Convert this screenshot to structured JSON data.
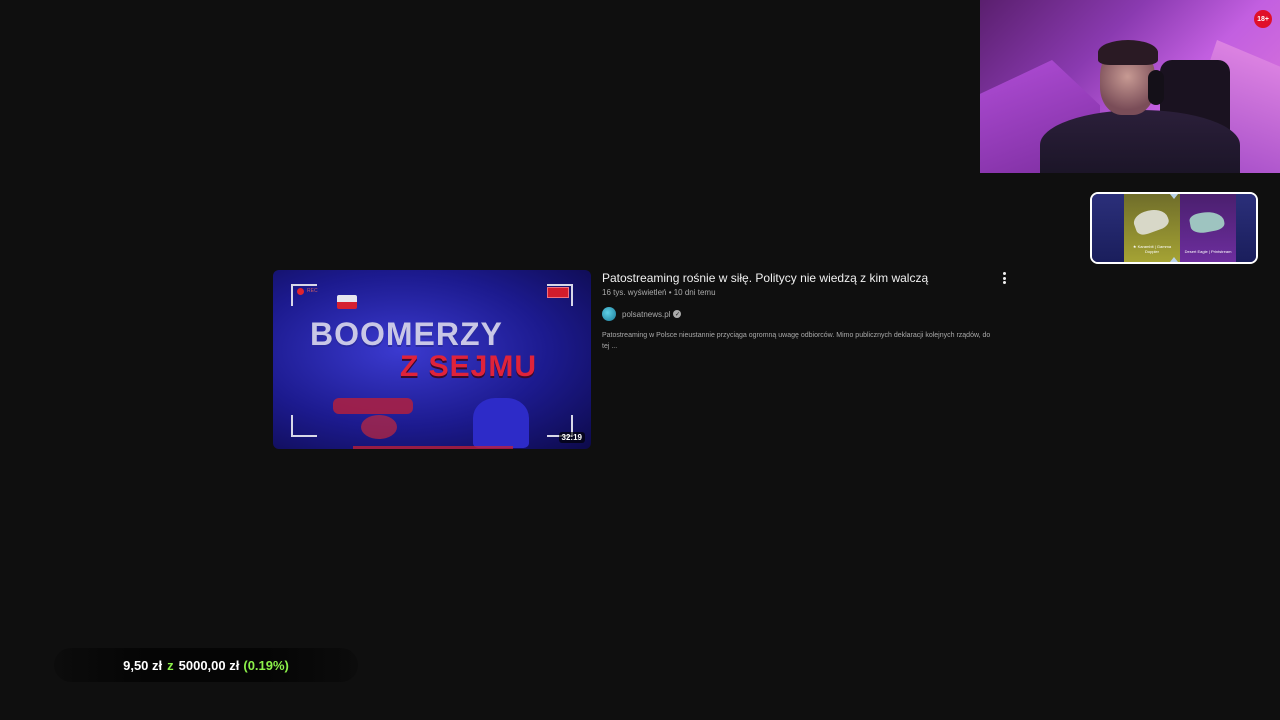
{
  "webcam": {
    "badge": "18+"
  },
  "carousel": {
    "items": [
      {
        "caption": ""
      },
      {
        "caption": "★ Karambit | Gamma Doppler"
      },
      {
        "caption": "Desert Eagle | Printstream"
      },
      {
        "caption": ""
      }
    ]
  },
  "video": {
    "title": "Patostreaming rośnie w siłę. Politycy nie wiedzą z kim walczą",
    "views": "16 tys. wyświetleń",
    "age": "10 dni temu",
    "meta_separator": " • ",
    "channel": "polsatnews.pl",
    "description": "Patostreaming w Polsce nieustannie przyciąga ogromną uwagę odbiorców. Mimo publicznych deklaracji kolejnych rządów, do tej ...",
    "duration": "32:19",
    "thumbnail": {
      "rec_label": "REC",
      "line1": "BOOMERZY",
      "line2": "Z SEJMU"
    }
  },
  "goal": {
    "current": "9,50 zł",
    "separator": "z",
    "target": "5000,00 zł",
    "percent": "(0.19%)",
    "progress_fraction": 0.0019,
    "accent_color": "#8cf24a"
  }
}
